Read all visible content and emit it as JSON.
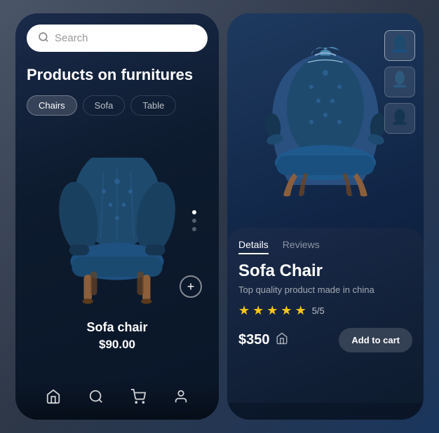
{
  "left": {
    "search": {
      "placeholder": "Search"
    },
    "section_title": "Products on furnitures",
    "categories": [
      {
        "label": "Chairs",
        "active": true
      },
      {
        "label": "Sofa",
        "active": false
      },
      {
        "label": "Table",
        "active": false
      }
    ],
    "product": {
      "name": "Sofa chair",
      "price": "$90.00"
    },
    "scroll_dots": [
      {
        "active": true
      },
      {
        "active": false
      },
      {
        "active": false
      }
    ],
    "nav": {
      "home": "⌂",
      "search": "🔍",
      "cart": "🛒",
      "profile": "👤"
    }
  },
  "right": {
    "tabs": [
      {
        "label": "Details",
        "active": true
      },
      {
        "label": "Reviews",
        "active": false
      }
    ],
    "product": {
      "title": "Sofa Chair",
      "description": "Top quality product made in china",
      "rating": "5/5",
      "stars": 5,
      "price": "$350",
      "add_to_cart": "Add to cart"
    },
    "image_dots": [
      {
        "active": true
      },
      {
        "active": false
      },
      {
        "active": false
      }
    ]
  }
}
